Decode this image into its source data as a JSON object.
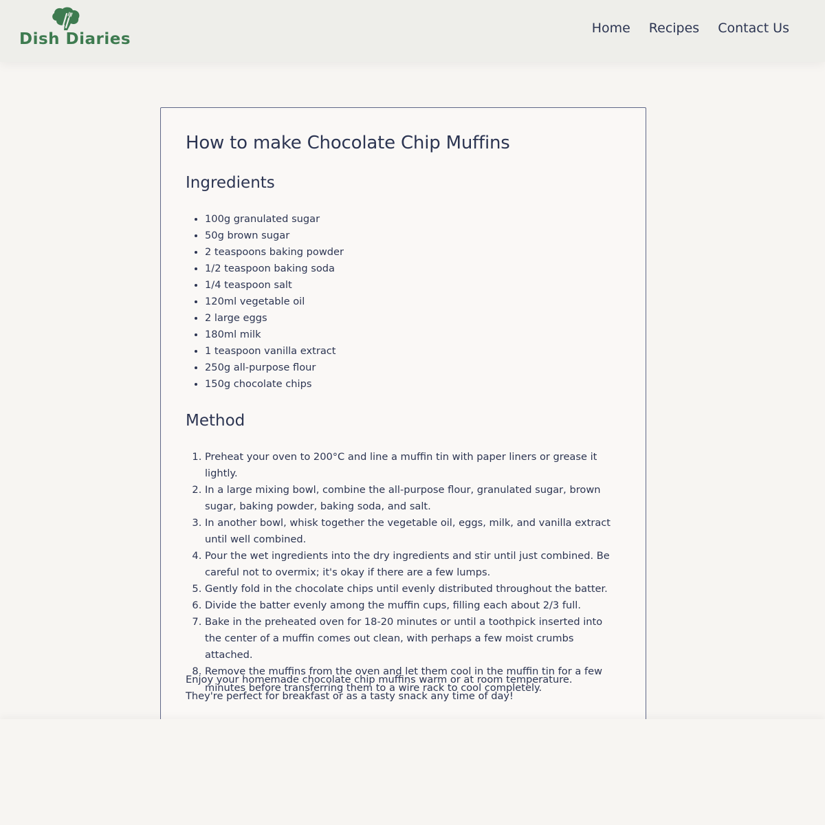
{
  "header": {
    "logo_text": "Dish Diaries",
    "nav": [
      "Home",
      "Recipes",
      "Contact Us"
    ]
  },
  "recipe": {
    "title": "How to make Chocolate Chip Muffins",
    "ingredients_heading": "Ingredients",
    "ingredients": [
      "100g granulated sugar",
      "50g brown sugar",
      "2 teaspoons baking powder",
      "1/2 teaspoon baking soda",
      "1/4 teaspoon salt",
      "120ml vegetable oil",
      "2 large eggs",
      "180ml milk",
      "1 teaspoon vanilla extract",
      "250g all-purpose flour",
      "150g chocolate chips"
    ],
    "method_heading": "Method",
    "steps": [
      "Preheat your oven to 200°C and line a muffin tin with paper liners or grease it lightly.",
      "In a large mixing bowl, combine the all-purpose flour, granulated sugar, brown sugar, baking powder, baking soda, and salt.",
      "In another bowl, whisk together the vegetable oil, eggs, milk, and vanilla extract until well combined.",
      "Pour the wet ingredients into the dry ingredients and stir until just combined. Be careful not to overmix; it's okay if there are a few lumps.",
      "Gently fold in the chocolate chips until evenly distributed throughout the batter.",
      "Divide the batter evenly among the muffin cups, filling each about 2/3 full.",
      "Bake in the preheated oven for 18-20 minutes or until a toothpick inserted into the center of a muffin comes out clean, with perhaps a few moist crumbs attached.",
      "Remove the muffins from the oven and let them cool in the muffin tin for a few minutes before transferring them to a wire rack to cool completely."
    ],
    "closing": "Enjoy your homemade chocolate chip muffins warm or at room temperature. They're perfect for breakfast or as a tasty snack any time of day!"
  },
  "colors": {
    "brand_green": "#3e7b50",
    "text": "#2c3552",
    "header_bg": "#eeeeea",
    "page_bg": "#f7f5f2"
  },
  "icons": {
    "logo": "broccoli-fork-logo-icon"
  }
}
